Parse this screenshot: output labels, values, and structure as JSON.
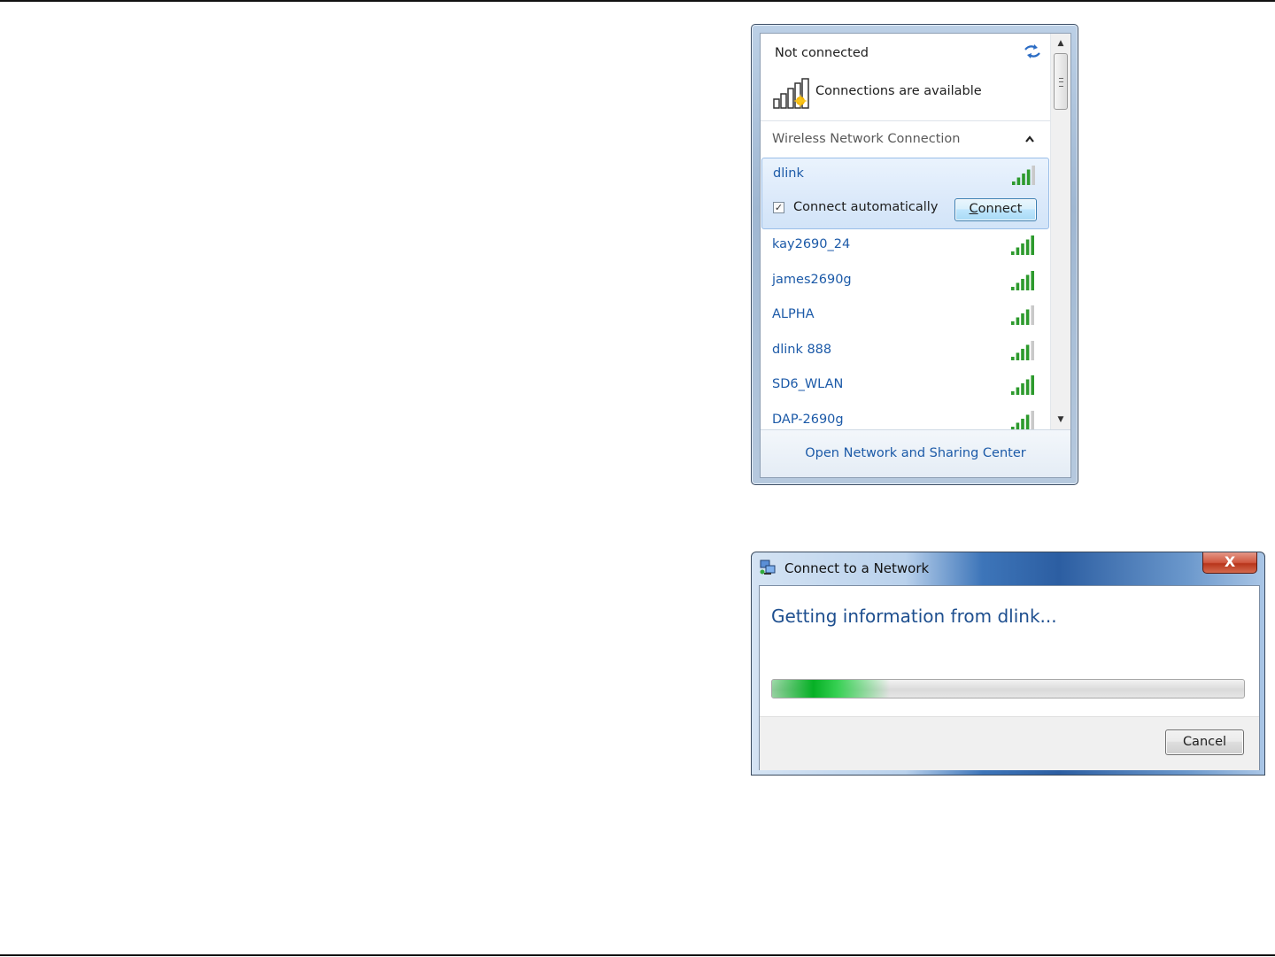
{
  "flyout": {
    "status_text": "Not connected",
    "availability_text": "Connections are available",
    "section_title": "Wireless Network Connection",
    "selected_network": {
      "name": "dlink",
      "signal_bars": 4,
      "connect_automatically_label": "Connect automatically",
      "connect_automatically_checked": true,
      "connect_button_label": "Connect",
      "connect_button_accesskey": "C",
      "connect_button_rest": "onnect"
    },
    "networks": [
      {
        "name": "kay2690_24",
        "signal_bars": 5
      },
      {
        "name": "james2690g",
        "signal_bars": 5
      },
      {
        "name": "ALPHA",
        "signal_bars": 4
      },
      {
        "name": "dlink 888",
        "signal_bars": 4
      },
      {
        "name": "SD6_WLAN",
        "signal_bars": 5
      },
      {
        "name": "DAP-2690g",
        "signal_bars": 4
      }
    ],
    "footer_link": "Open Network and Sharing Center"
  },
  "dialog": {
    "title": "Connect to a Network",
    "close_label": "X",
    "heading": "Getting information from dlink...",
    "progress_fraction": 0.25,
    "cancel_label": "Cancel"
  },
  "colors": {
    "link_blue": "#1c5aa8",
    "signal_green": "#2d9a2d",
    "progress_green": "#06b025"
  },
  "icons": {
    "refresh": "refresh-icon",
    "availability": "wireless-available-icon",
    "collapse": "chevron-up-icon",
    "signal": "signal-strength-icon",
    "dialog": "network-icon",
    "close": "close-icon"
  }
}
